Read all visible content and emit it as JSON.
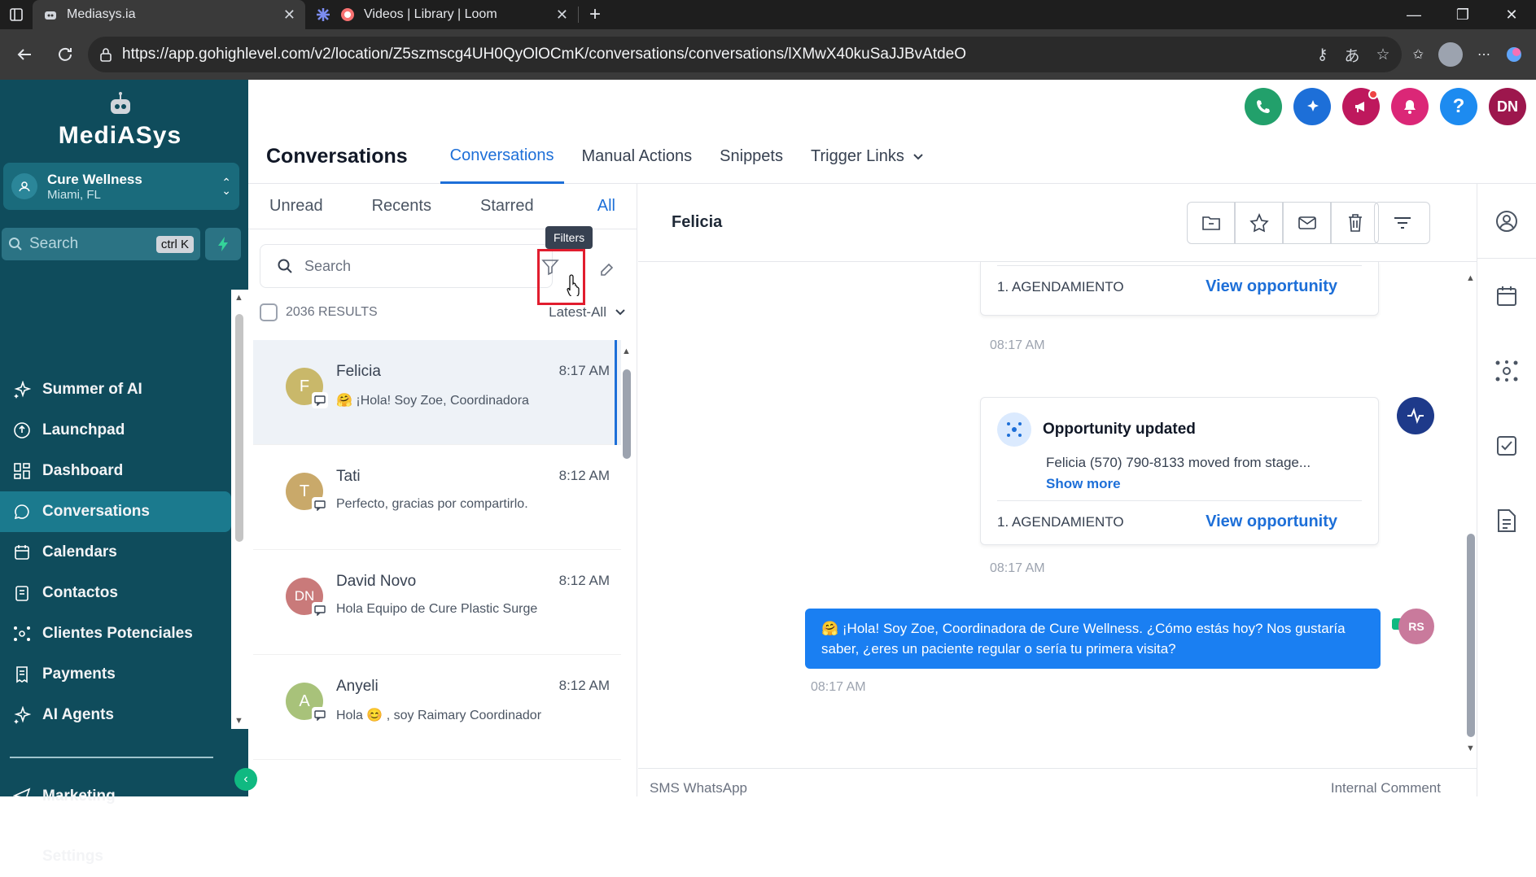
{
  "browser": {
    "tabs": [
      {
        "title": "Mediasys.ia",
        "icon": "mediasys-favicon"
      },
      {
        "title": "Videos | Library | Loom",
        "icon": "loom-favicon"
      }
    ],
    "url": "https://app.gohighlevel.com/v2/location/Z5szmscg4UH0QyOlOCmK/conversations/conversations/lXMwX40kuSaJJBvAtdeO"
  },
  "sidebar": {
    "brand": "MediASys",
    "location": {
      "name": "Cure Wellness",
      "city": "Miami, FL"
    },
    "search": {
      "placeholder": "Search",
      "shortcut": "ctrl K"
    },
    "items": [
      {
        "label": "Summer of AI",
        "icon": "sparkle-icon"
      },
      {
        "label": "Launchpad",
        "icon": "rocket-icon"
      },
      {
        "label": "Dashboard",
        "icon": "grid-icon"
      },
      {
        "label": "Conversations",
        "icon": "chat-icon",
        "active": true
      },
      {
        "label": "Calendars",
        "icon": "calendar-icon"
      },
      {
        "label": "Contactos",
        "icon": "contact-icon"
      },
      {
        "label": "Clientes Potenciales",
        "icon": "network-icon"
      },
      {
        "label": "Payments",
        "icon": "receipt-icon"
      },
      {
        "label": "AI Agents",
        "icon": "sparkle-icon"
      }
    ],
    "bottom_items": [
      {
        "label": "Marketing",
        "icon": "send-icon"
      },
      {
        "label": "Settings",
        "icon": "gear-icon"
      }
    ]
  },
  "header": {
    "title": "Conversations",
    "tabs": [
      "Conversations",
      "Manual Actions",
      "Snippets",
      "Trigger Links"
    ],
    "user_initials": "DN"
  },
  "list": {
    "filter_tabs": [
      "Unread",
      "Recents",
      "Starred",
      "All"
    ],
    "search_placeholder": "Search",
    "tooltip": "Filters",
    "results": "2036 RESULTS",
    "sort": "Latest-All",
    "conversations": [
      {
        "initial": "F",
        "name": "Felicia",
        "time": "8:17 AM",
        "message": "🤗 ¡Hola! Soy Zoe, Coordinadora",
        "color": "#c9b86a"
      },
      {
        "initial": "T",
        "name": "Tati",
        "time": "8:12 AM",
        "message": "Perfecto, gracias por compartirlo.",
        "color": "#c9a96a"
      },
      {
        "initial": "DN",
        "name": "David Novo",
        "time": "8:12 AM",
        "message": "Hola Equipo de Cure Plastic Surge",
        "color": "#c97a7a"
      },
      {
        "initial": "A",
        "name": "Anyeli",
        "time": "8:12 AM",
        "message": "Hola 😊 , soy Raimary Coordinador",
        "color": "#a8c27a"
      }
    ]
  },
  "chat": {
    "contact": "Felicia",
    "card1": {
      "stage": "1. AGENDAMIENTO",
      "link": "View opportunity",
      "time": "08:17 AM"
    },
    "card2": {
      "title": "Opportunity updated",
      "text": "Felicia (570) 790-8133 moved from stage...",
      "more": "Show more",
      "stage": "1. AGENDAMIENTO",
      "link": "View opportunity",
      "time": "08:17 AM"
    },
    "message": {
      "text": "🤗 ¡Hola! Soy Zoe, Coordinadora de Cure Wellness. ¿Cómo estás hoy? Nos gustaría saber, ¿eres un paciente regular o sería tu primera visita?",
      "time": "08:17 AM",
      "sender_initials": "RS"
    },
    "composer": {
      "channels": "SMS   WhatsApp",
      "internal": "Internal Comment"
    }
  }
}
